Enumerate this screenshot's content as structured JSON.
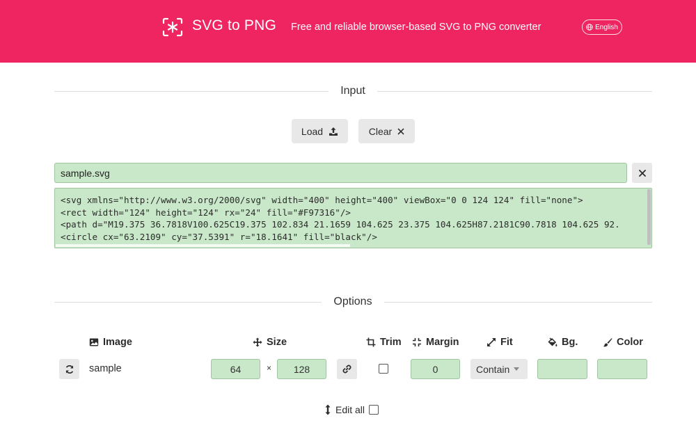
{
  "header": {
    "brand": "SVG to PNG",
    "tagline": "Free and reliable browser-based SVG to PNG converter",
    "language": "English",
    "background_color": "#ee2561"
  },
  "input_section": {
    "title": "Input",
    "load_label": "Load",
    "clear_label": "Clear",
    "filename": "sample.svg",
    "code_lines": [
      "<svg xmlns=\"http://www.w3.org/2000/svg\" width=\"400\" height=\"400\" viewBox=\"0 0 124 124\" fill=\"none\">",
      "<rect width=\"124\" height=\"124\" rx=\"24\" fill=\"#F97316\"/>",
      "<path d=\"M19.375 36.7818V100.625C19.375 102.834 21.1659 104.625 23.375 104.625H87.2181C90.7818 104.625 92.",
      "<circle cx=\"63.2109\" cy=\"37.5391\" r=\"18.1641\" fill=\"black\"/>"
    ]
  },
  "options_section": {
    "title": "Options",
    "columns": {
      "image": "Image",
      "size": "Size",
      "trim": "Trim",
      "margin": "Margin",
      "fit": "Fit",
      "bg": "Bg.",
      "color": "Color"
    },
    "row": {
      "name": "sample",
      "width": "64",
      "times": "×",
      "height": "128",
      "margin": "0",
      "fit": "Contain",
      "bg": "",
      "color": ""
    },
    "edit_all_label": "Edit all"
  },
  "colors": {
    "accent": "#ee2561",
    "input_fill": "#c9e8c9",
    "button_fill": "#e8e8e8"
  }
}
